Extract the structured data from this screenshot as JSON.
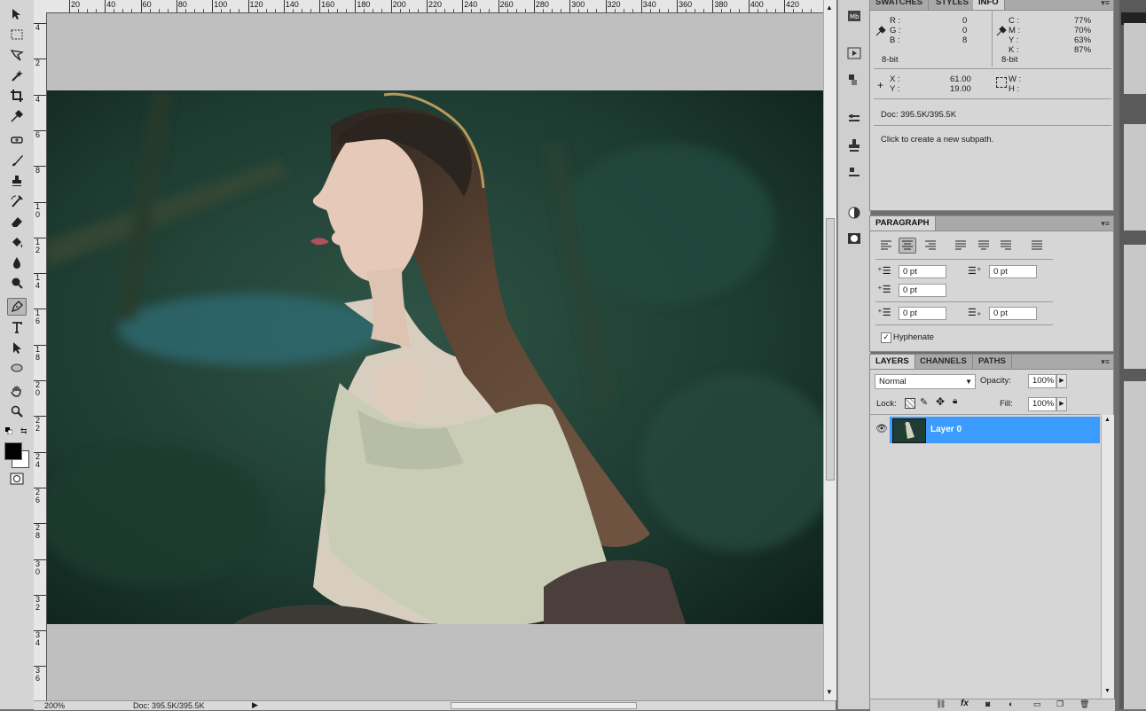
{
  "ruler": {
    "h_ticks": [
      "20",
      "40",
      "60",
      "80",
      "100",
      "120",
      "140",
      "160",
      "180",
      "200",
      "220",
      "240",
      "260",
      "280",
      "300",
      "320",
      "340",
      "360",
      "380",
      "400",
      "420"
    ],
    "v_ticks": [
      "4",
      "2",
      "4",
      "6",
      "8",
      "1\n0",
      "1\n2",
      "1\n4",
      "1\n6",
      "1\n8",
      "2\n0",
      "2\n2",
      "2\n4",
      "2\n6",
      "2\n8",
      "3\n0",
      "3\n2",
      "3\n4",
      "3\n6"
    ]
  },
  "status": {
    "zoom": "200%",
    "doc": "Doc: 395.5K/395.5K"
  },
  "info_panel": {
    "tabs": [
      "SWATCHES",
      "STYLES",
      "INFO"
    ],
    "rgb": {
      "r_label": "R :",
      "g_label": "G :",
      "b_label": "B :",
      "r": "0",
      "g": "0",
      "b": "8"
    },
    "cmyk": {
      "c_label": "C :",
      "m_label": "M :",
      "y_label": "Y :",
      "k_label": "K :",
      "c": "77%",
      "m": "70%",
      "y": "63%",
      "k": "87%"
    },
    "bit_left": "8-bit",
    "bit_right": "8-bit",
    "xy": {
      "x_label": "X :",
      "y_label": "Y :",
      "x": "61.00",
      "y": "19.00"
    },
    "wh": {
      "w_label": "W :",
      "h_label": "H :"
    },
    "doc": "Doc: 395.5K/395.5K",
    "hint": "Click to create a new subpath."
  },
  "paragraph_panel": {
    "tab": "PARAGRAPH",
    "indent_left": "0 pt",
    "indent_right": "0 pt",
    "indent_first": "0 pt",
    "space_before": "0 pt",
    "space_after": "0 pt",
    "hyphenate": "Hyphenate"
  },
  "layers_panel": {
    "tabs": [
      "LAYERS",
      "CHANNELS",
      "PATHS"
    ],
    "blend_mode": "Normal",
    "opacity_label": "Opacity:",
    "opacity": "100%",
    "lock_label": "Lock:",
    "fill_label": "Fill:",
    "fill": "100%",
    "layer_name": "Layer 0"
  },
  "colors": {
    "accent": "#3b9bff",
    "foreground": "#000000",
    "background": "#ffffff"
  }
}
